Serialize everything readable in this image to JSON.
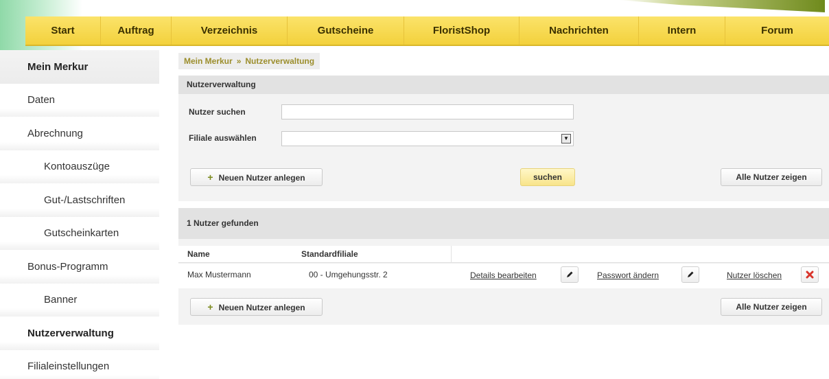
{
  "nav": {
    "items": [
      "Start",
      "Auftrag",
      "Verzeichnis",
      "Gutscheine",
      "FloristShop",
      "Nachrichten",
      "Intern",
      "Forum"
    ]
  },
  "sidebar": {
    "items": [
      {
        "label": "Mein Merkur"
      },
      {
        "label": "Daten"
      },
      {
        "label": "Abrechnung"
      },
      {
        "label": "Kontoauszüge"
      },
      {
        "label": "Gut-/Lastschriften"
      },
      {
        "label": "Gutscheinkarten"
      },
      {
        "label": "Bonus-Programm"
      },
      {
        "label": "Banner"
      },
      {
        "label": "Nutzerverwaltung"
      },
      {
        "label": "Filialeinstellungen"
      }
    ]
  },
  "breadcrumb": {
    "root": "Mein Merkur",
    "separator": "»",
    "current": "Nutzerverwaltung"
  },
  "search": {
    "title": "Nutzerverwaltung",
    "user_label": "Nutzer suchen",
    "user_value": "",
    "branch_label": "Filiale auswählen",
    "branch_value": "",
    "new_user_label": "Neuen Nutzer anlegen",
    "search_label": "suchen",
    "show_all_label": "Alle Nutzer zeigen"
  },
  "results": {
    "summary": "1 Nutzer gefunden",
    "columns": [
      "Name",
      "Standardfiliale"
    ],
    "rows": [
      {
        "name": "Max Mustermann",
        "branch": "00 - Umgehungsstr. 2",
        "edit_details": "Details bearbeiten",
        "change_password": "Passwort ändern",
        "delete_user": "Nutzer löschen"
      }
    ],
    "new_user_label": "Neuen Nutzer anlegen",
    "show_all_label": "Alle Nutzer zeigen"
  },
  "colors": {
    "nav_yellow": "#f6d84a",
    "breadcrumb_olive": "#9c8e2c",
    "delete_red": "#d9342b"
  }
}
